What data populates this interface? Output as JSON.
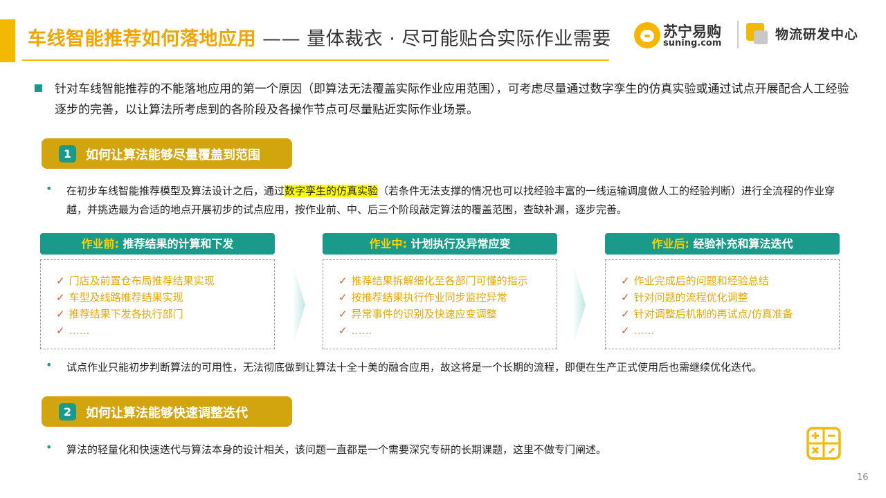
{
  "header": {
    "title_highlight": "车线智能推荐如何落地应用",
    "title_rest": " —— 量体裁衣 · 尽可能贴合实际作业需要"
  },
  "logos": {
    "suning_cn": "苏宁易购",
    "suning_en": "suning.com",
    "dept": "物流研发中心"
  },
  "intro": "针对车线智能推荐的不能落地应用的第一个原因（即算法无法覆盖实际作业应用范围），可考虑尽量通过数字孪生的仿真实验或通过试点开展配合人工经验逐步的完善，以让算法所考虑到的各阶段及各操作节点可尽量贴近实际作业场景。",
  "section1": {
    "num": "1",
    "title": "如何让算法能够尽量覆盖到范围",
    "bullet_pre": "在初步车线智能推荐模型及算法设计之后，通过",
    "bullet_highlight": "数字孪生的仿真实验",
    "bullet_post": "（若条件无法支撑的情况也可以找经验丰富的一线运输调度做人工的经验判断）进行全流程的作业穿越，并挑选最为合适的地点开展初步的试点应用，按作业前、中、后三个阶段敲定算法的覆盖范围，查缺补漏，逐步完善。",
    "phases": [
      {
        "key": "作业前:",
        "title": " 推荐结果的计算和下发",
        "items": [
          "门店及前置仓布局推荐结果实现",
          "车型及线路推荐结果实现",
          "推荐结果下发各执行部门",
          "……"
        ]
      },
      {
        "key": "作业中:",
        "title": " 计划执行及异常应变",
        "items": [
          "推荐结果拆解细化至各部门可懂的指示",
          "按推荐结果执行作业同步监控异常",
          "异常事件的识别及快速应变调整",
          "……"
        ]
      },
      {
        "key": "作业后:",
        "title": " 经验补充和算法迭代",
        "items": [
          "作业完成后的问题和经验总结",
          "针对问题的流程优化调整",
          "针对调整后机制的再试点/仿真准备",
          "……"
        ]
      }
    ],
    "note": "试点作业只能初步判断算法的可用性，无法彻底做到让算法十全十美的融合应用，故这将是一个长期的流程，即便在生产正式使用后也需继续优化迭代。"
  },
  "section2": {
    "num": "2",
    "title": "如何让算法能够快速调整迭代",
    "bullet": "算法的轻量化和快速迭代与算法本身的设计相关，该问题一直都是一个需要深究专研的长期课题，这里不做专门阐述。"
  },
  "page_number": "16",
  "colors": {
    "accent": "#f3b800",
    "teal": "#1a9a8a",
    "pill": "#d2a50e",
    "item_text": "#e6a800",
    "check": "#e05a2a"
  }
}
